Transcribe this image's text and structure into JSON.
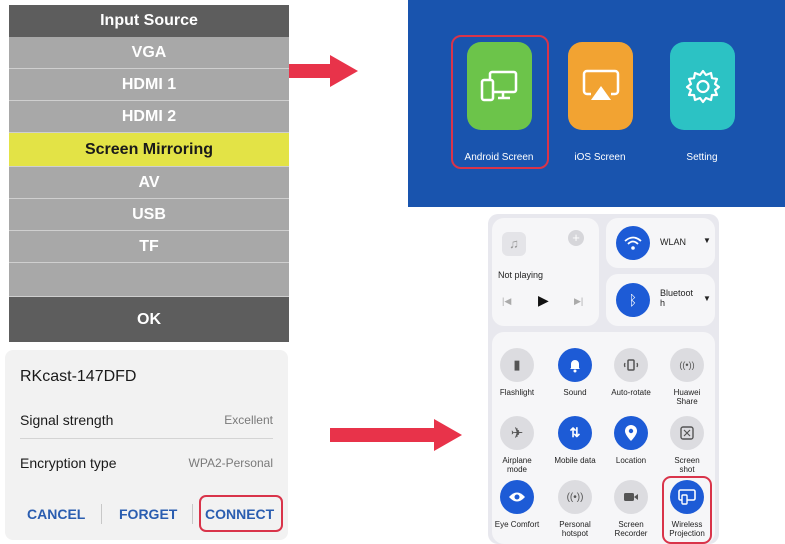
{
  "input_menu": {
    "title": "Input Source",
    "items": [
      "VGA",
      "HDMI 1",
      "HDMI 2",
      "Screen Mirroring",
      "AV",
      "USB",
      "TF",
      ""
    ],
    "ok_label": "OK"
  },
  "projector": {
    "tiles": [
      {
        "label": "Android Screen",
        "icon": "android-screen-icon",
        "color": "#6cc44a"
      },
      {
        "label": "iOS Screen",
        "icon": "airplay-icon",
        "color": "#f2a332"
      },
      {
        "label": "Setting",
        "icon": "gear-icon",
        "color": "#2cc2c4"
      }
    ]
  },
  "wifi_dialog": {
    "network_name": "RKcast-147DFD",
    "signal_label": "Signal strength",
    "signal_value": "Excellent",
    "encryption_label": "Encryption type",
    "encryption_value": "WPA2-Personal",
    "cancel_label": "CANCEL",
    "forget_label": "FORGET",
    "connect_label": "CONNECT"
  },
  "control_panel": {
    "media_status": "Not playing",
    "wlan_label": "WLAN",
    "bluetooth_label": "Bluetoot\nh",
    "toggles": [
      {
        "label": "Flashlight",
        "icon": "flashlight-icon",
        "active": false
      },
      {
        "label": "Sound",
        "icon": "bell-icon",
        "active": true
      },
      {
        "label": "Auto-rotate",
        "icon": "rotate-icon",
        "active": false
      },
      {
        "label": "Huawei\nShare",
        "icon": "share-icon",
        "active": false
      },
      {
        "label": "Airplane\nmode",
        "icon": "airplane-icon",
        "active": false
      },
      {
        "label": "Mobile data",
        "icon": "mobile-data-icon",
        "active": true
      },
      {
        "label": "Location",
        "icon": "location-icon",
        "active": true
      },
      {
        "label": "Screen\nshot",
        "icon": "screenshot-icon",
        "active": false
      },
      {
        "label": "Eye Comfort",
        "icon": "eye-icon",
        "active": true
      },
      {
        "label": "Personal\nhotspot",
        "icon": "hotspot-icon",
        "active": false
      },
      {
        "label": "Screen\nRecorder",
        "icon": "recorder-icon",
        "active": false
      },
      {
        "label": "Wireless\nProjection",
        "icon": "projection-icon",
        "active": true
      }
    ]
  },
  "colors": {
    "arrow": "#e8334a",
    "highlight_outline": "#d9344a",
    "menu_highlight": "#e3e346",
    "projector_bg": "#1954ae",
    "accent_blue": "#1d5bd6"
  }
}
